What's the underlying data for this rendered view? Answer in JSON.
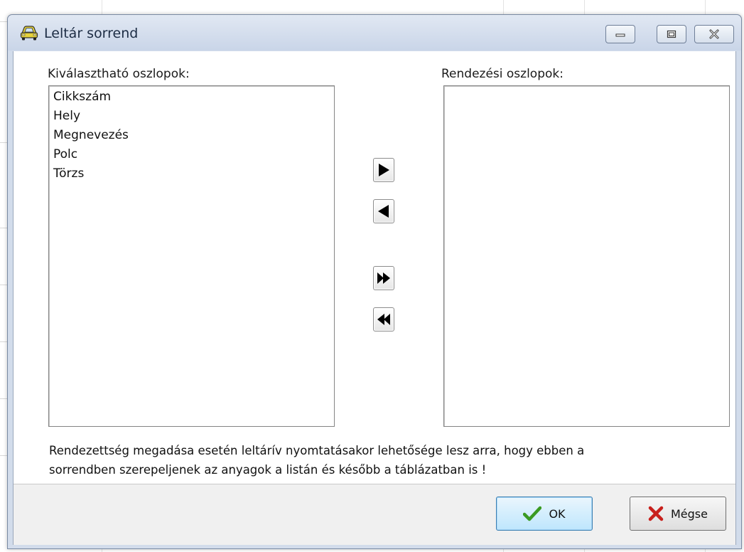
{
  "window": {
    "title": "Leltár sorrend"
  },
  "labels": {
    "available": "Kiválasztható oszlopok:",
    "sort": "Rendezési oszlopok:"
  },
  "available_items": [
    "Cikkszám",
    "Hely",
    "Megnevezés",
    "Polc",
    "Törzs"
  ],
  "sort_items": [],
  "info": {
    "line1": "Rendezettség megadása esetén leltárív nyomtatásakor lehetősége lesz arra, hogy ebben a",
    "line2": "sorrendben szerepeljenek az anyagok a listán és később a táblázatban is !"
  },
  "buttons": {
    "ok": "OK",
    "cancel": "Mégse"
  },
  "icons": {
    "title": "car-icon",
    "minimize": "minimize-icon",
    "maximize": "maximize-icon",
    "close": "close-icon",
    "move_right": "triangle-right-icon",
    "move_left": "triangle-left-icon",
    "move_all_right": "double-triangle-right-icon",
    "move_all_left": "double-triangle-left-icon",
    "ok": "checkmark-icon",
    "cancel": "red-x-icon"
  },
  "colors": {
    "ok_check": "#3a9a22",
    "cancel_x": "#c8201c",
    "title_bar": "#d2dceb"
  }
}
